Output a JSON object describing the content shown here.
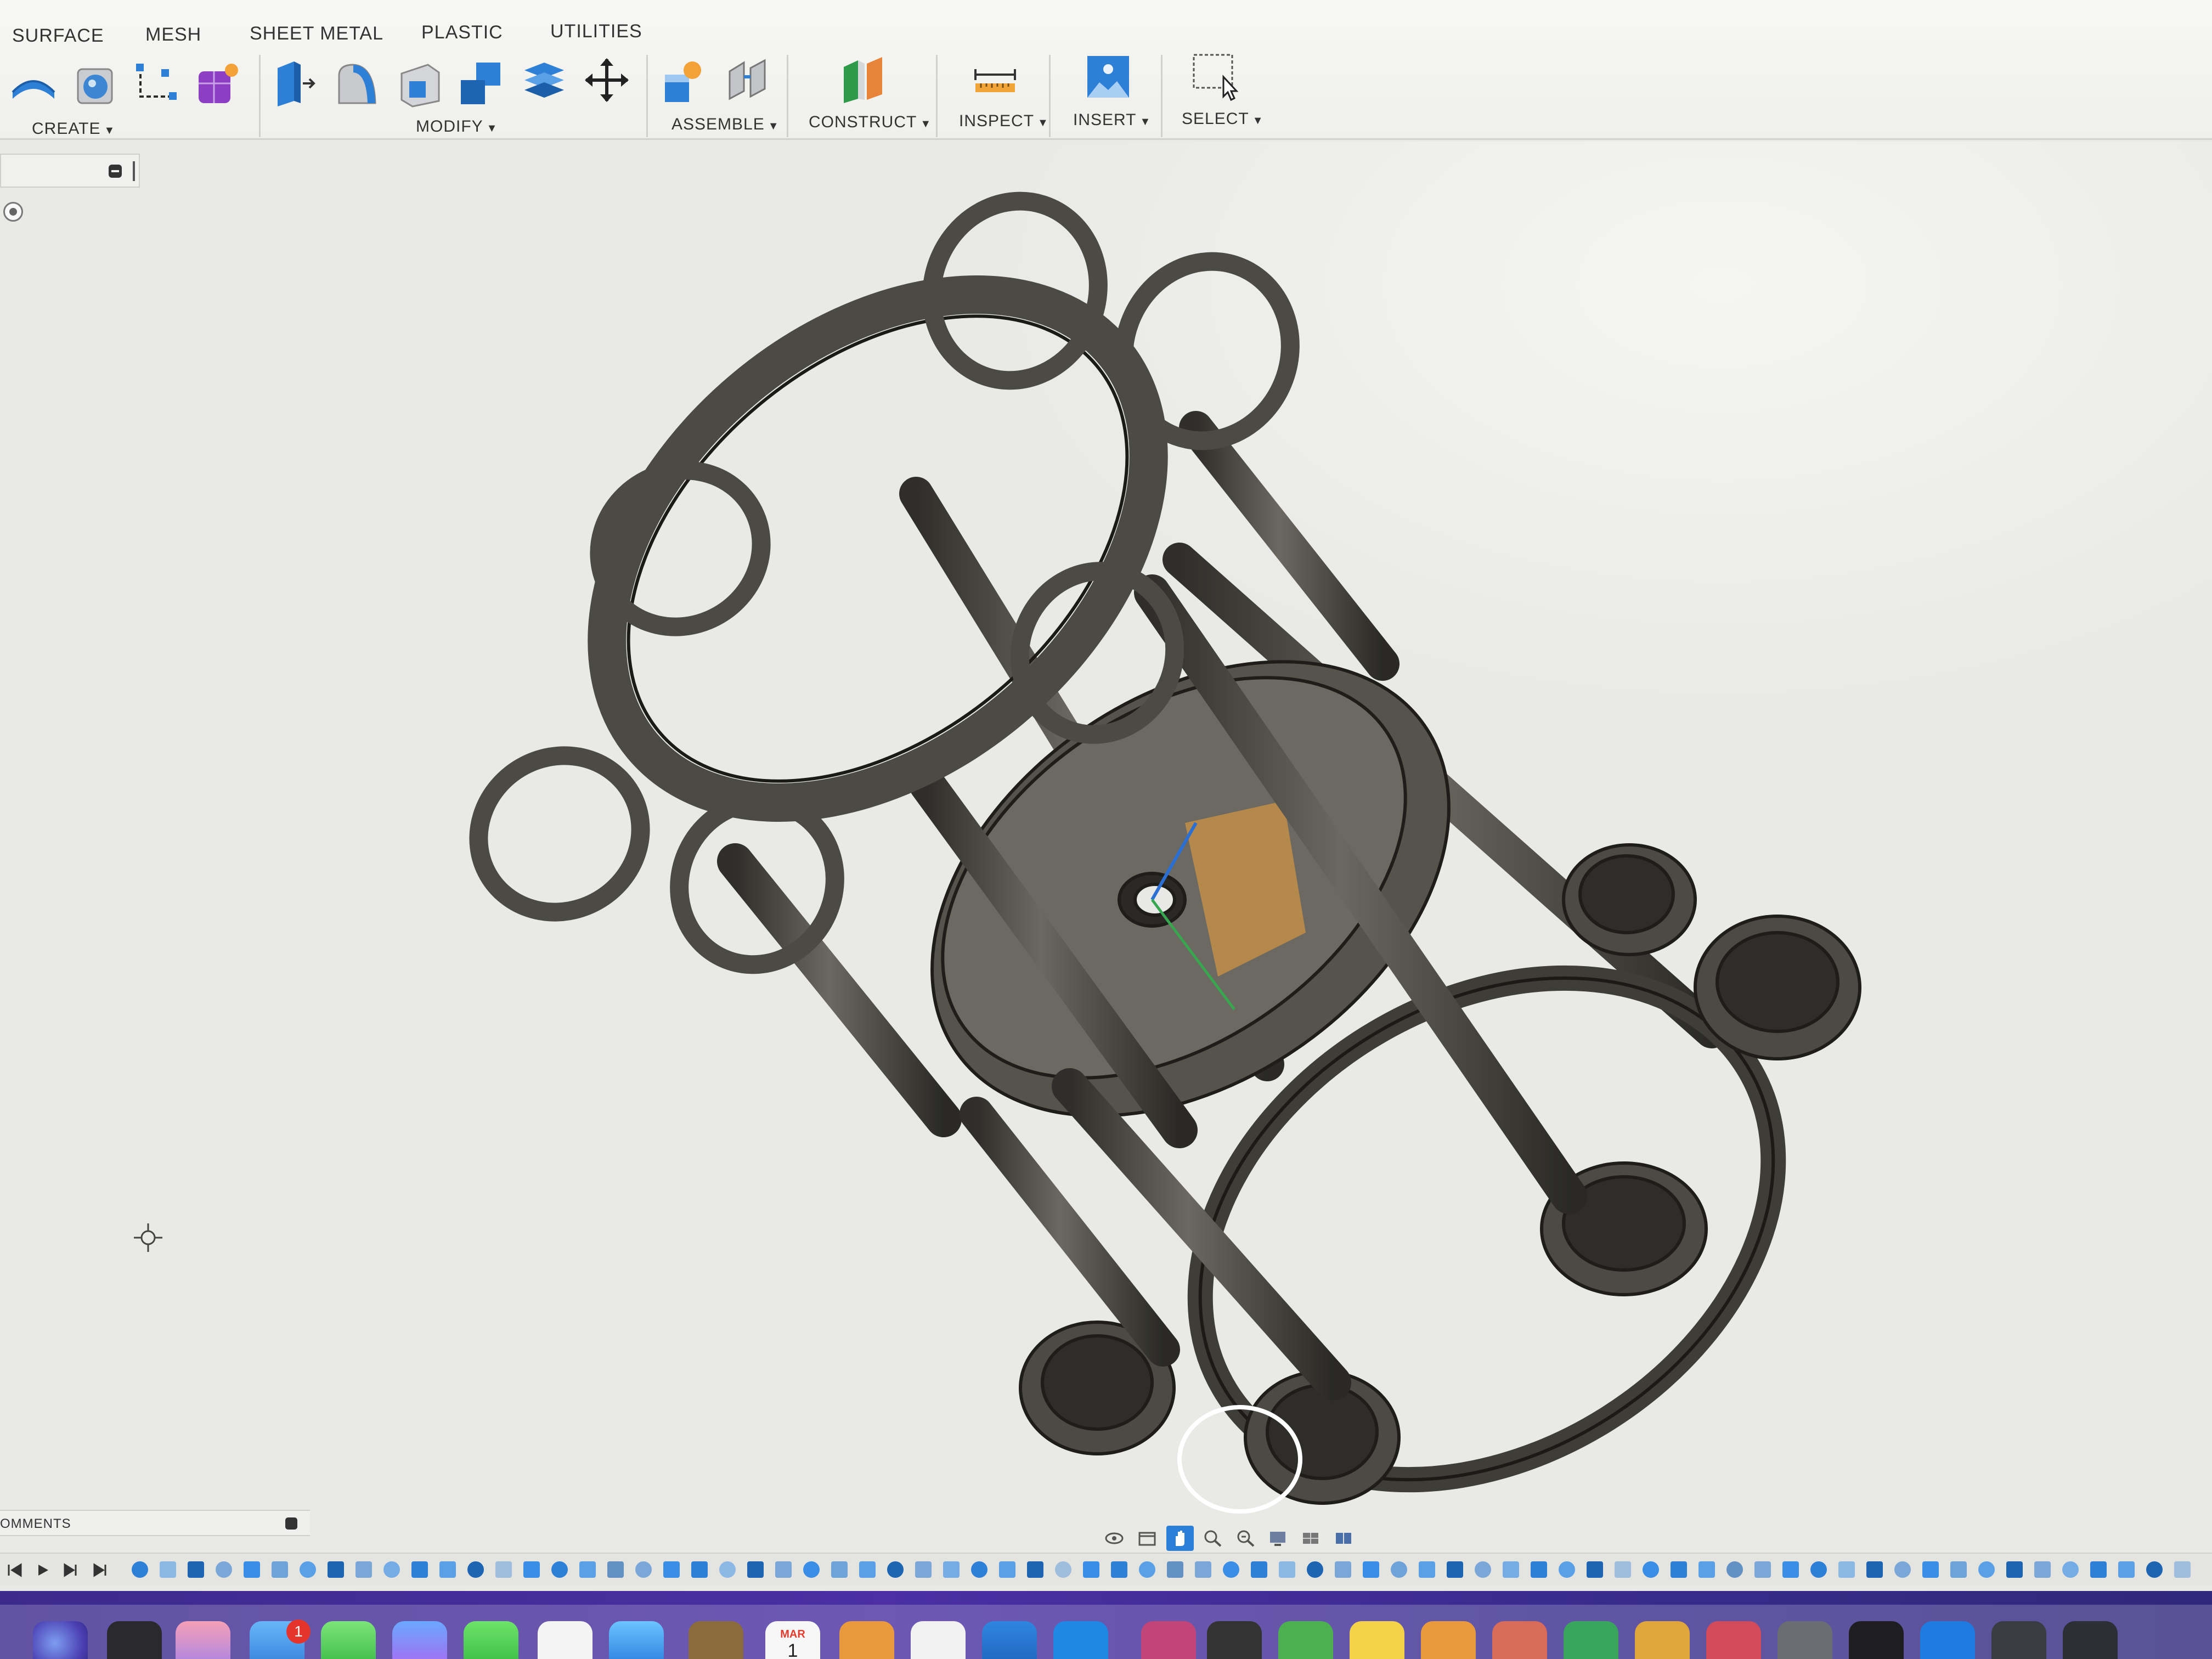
{
  "toolbar": {
    "tabs": {
      "surface": "SURFACE",
      "mesh": "MESH",
      "sheet_metal": "SHEET METAL",
      "plastic": "PLASTIC",
      "utilities": "UTILITIES"
    },
    "groups": {
      "create": "CREATE",
      "modify": "MODIFY",
      "assemble": "ASSEMBLE",
      "construct": "CONSTRUCT",
      "inspect": "INSPECT",
      "insert": "INSERT",
      "select": "SELECT"
    },
    "create_tools": [
      "extrude-surface-icon",
      "revolve-sphere-icon",
      "sketch-lines-icon",
      "create-form-icon"
    ],
    "modify_tools": [
      "press-pull-icon",
      "fillet-icon",
      "shell-icon",
      "combine-icon",
      "offset-face-icon",
      "move-icon"
    ],
    "assemble_tools": [
      "new-component-icon",
      "joint-icon"
    ],
    "construct_tools": [
      "offset-plane-icon"
    ],
    "inspect_tools": [
      "measure-icon"
    ],
    "insert_tools": [
      "insert-image-icon"
    ],
    "select_tools": [
      "window-select-icon"
    ]
  },
  "comments": {
    "label": "OMMENTS"
  },
  "dock": {
    "mail_badge": "1",
    "calendar_month": "MAR",
    "calendar_day": "1"
  },
  "colors": {
    "accent": "#2c7fd8",
    "model": "#4b4a44",
    "canvas": "#e9eae6",
    "toolbar": "#f4f4f2"
  }
}
